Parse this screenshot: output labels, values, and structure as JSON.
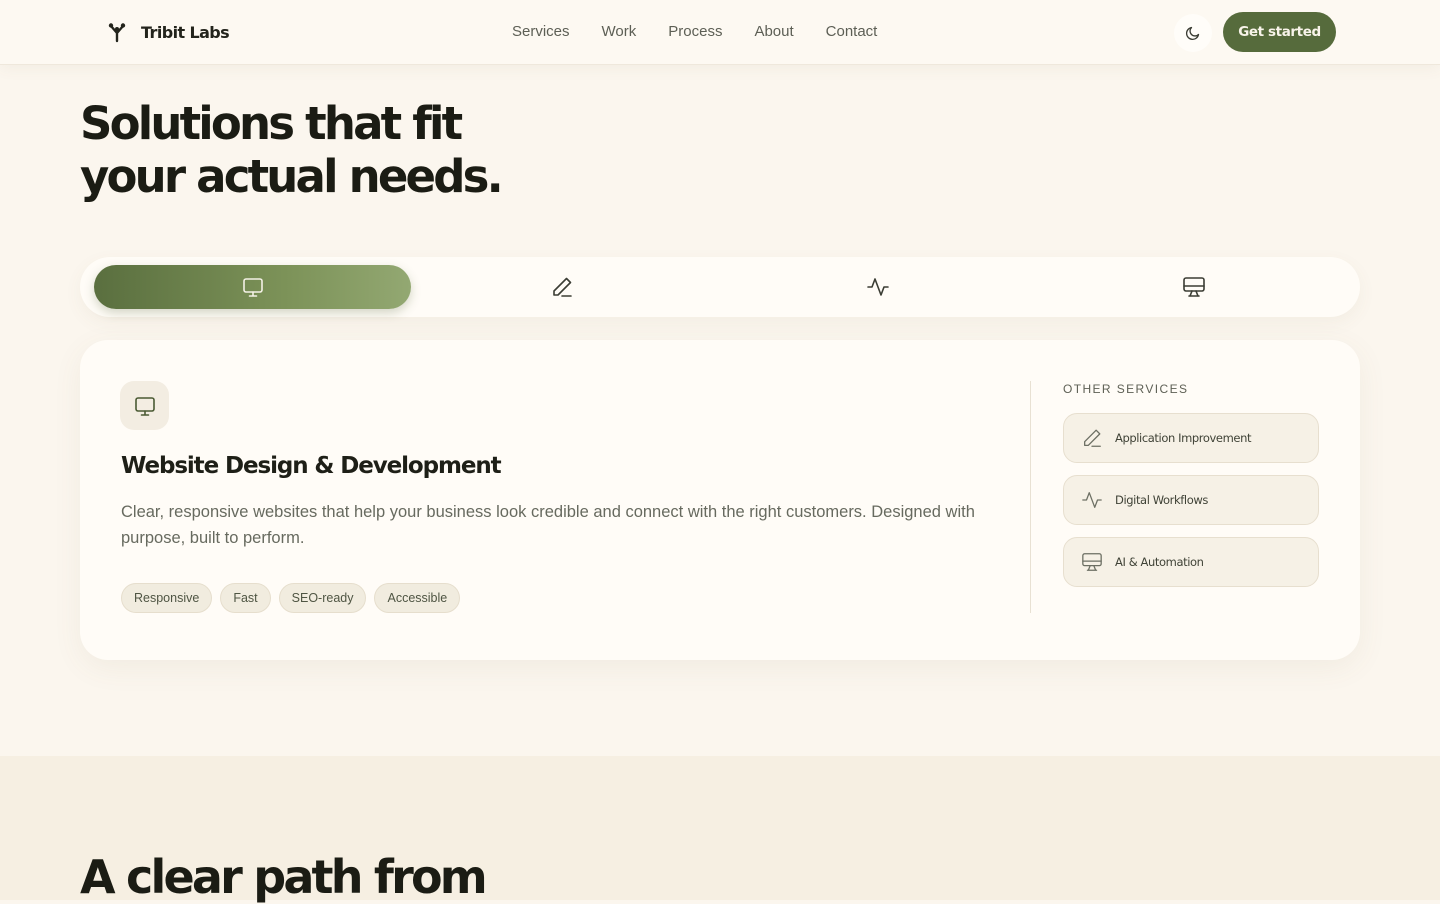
{
  "header": {
    "brand": "Tribit Labs",
    "brand_icon": "branch-logo-icon",
    "nav": [
      "Services",
      "Work",
      "Process",
      "About",
      "Contact"
    ],
    "theme_icon": "moon-icon",
    "cta_label": "Get started"
  },
  "hero": {
    "title_line1": "Solutions that fit",
    "title_line2": "your actual needs."
  },
  "tabs": [
    {
      "icon": "monitor-icon",
      "active": true
    },
    {
      "icon": "pen-icon",
      "active": false
    },
    {
      "icon": "activity-icon",
      "active": false
    },
    {
      "icon": "presentation-icon",
      "active": false
    }
  ],
  "service": {
    "icon": "monitor-icon",
    "title": "Website Design & Development",
    "description": "Clear, responsive websites that help your business look credible and connect with the right customers. Designed with purpose, built to perform.",
    "tags": [
      "Responsive",
      "Fast",
      "SEO-ready",
      "Accessible"
    ]
  },
  "other_services": {
    "label": "OTHER SERVICES",
    "items": [
      {
        "label": "Application Improvement",
        "icon": "pen-icon"
      },
      {
        "label": "Digital Workflows",
        "icon": "activity-icon"
      },
      {
        "label": "AI & Automation",
        "icon": "presentation-icon"
      }
    ]
  },
  "next_section": {
    "title": "A clear path from"
  },
  "colors": {
    "page_bg": "#fbf6ee",
    "accent": "#566b3c",
    "text": "#1e1f17",
    "muted": "#676a5f"
  }
}
